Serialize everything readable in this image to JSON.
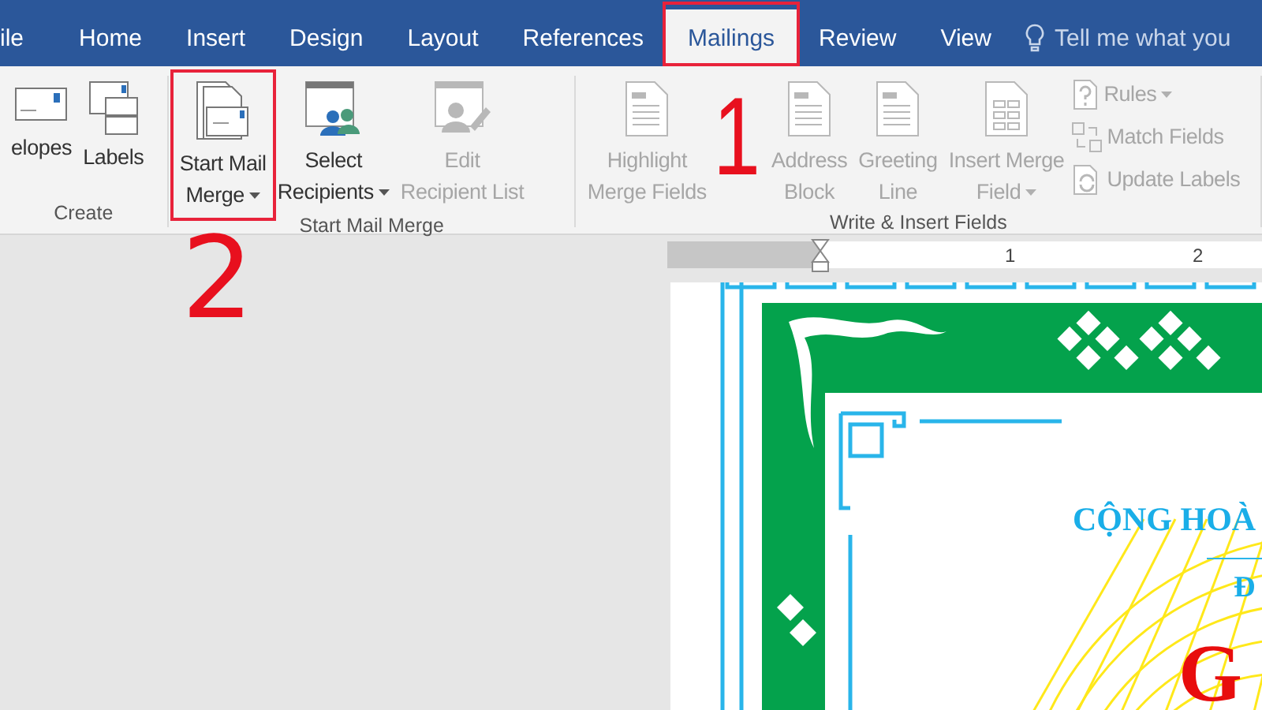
{
  "tabs": [
    {
      "label": "ile",
      "selected": false,
      "annotated": false
    },
    {
      "label": "Home",
      "selected": false,
      "annotated": false
    },
    {
      "label": "Insert",
      "selected": false,
      "annotated": false
    },
    {
      "label": "Design",
      "selected": false,
      "annotated": false
    },
    {
      "label": "Layout",
      "selected": false,
      "annotated": false
    },
    {
      "label": "References",
      "selected": false,
      "annotated": false
    },
    {
      "label": "Mailings",
      "selected": true,
      "annotated": true
    },
    {
      "label": "Review",
      "selected": false,
      "annotated": false
    },
    {
      "label": "View",
      "selected": false,
      "annotated": false
    }
  ],
  "search": {
    "placeholder": "Tell me what you"
  },
  "groups": [
    {
      "label": "Create",
      "items": [
        {
          "kind": "large",
          "lines": [
            "elopes"
          ],
          "dropdown": false,
          "disabled": false,
          "annotated": false
        },
        {
          "kind": "large",
          "lines": [
            "Labels"
          ],
          "dropdown": false,
          "disabled": false,
          "annotated": false
        }
      ]
    },
    {
      "label": "Start Mail Merge",
      "items": [
        {
          "kind": "large",
          "lines": [
            "Start Mail",
            "Merge"
          ],
          "dropdown": true,
          "disabled": false,
          "annotated": true
        },
        {
          "kind": "large",
          "lines": [
            "Select",
            "Recipients"
          ],
          "dropdown": true,
          "disabled": false,
          "annotated": false
        },
        {
          "kind": "large",
          "lines": [
            "Edit",
            "Recipient List"
          ],
          "dropdown": false,
          "disabled": true,
          "annotated": false
        }
      ]
    },
    {
      "label": "Write & Insert Fields",
      "items": [
        {
          "kind": "large",
          "lines": [
            "Highlight",
            "Merge Fields"
          ],
          "dropdown": false,
          "disabled": true,
          "annotated": false
        },
        {
          "kind": "large",
          "lines": [
            "Address",
            "Block"
          ],
          "dropdown": false,
          "disabled": true,
          "annotated": false
        },
        {
          "kind": "large",
          "lines": [
            "Greeting",
            "Line"
          ],
          "dropdown": false,
          "disabled": true,
          "annotated": false
        },
        {
          "kind": "large",
          "lines": [
            "Insert Merge",
            "Field"
          ],
          "dropdown": true,
          "disabled": true,
          "annotated": false
        },
        {
          "kind": "small",
          "lines": [
            "Rules"
          ],
          "dropdown": true,
          "disabled": true
        },
        {
          "kind": "small",
          "lines": [
            "Match Fields"
          ],
          "dropdown": false,
          "disabled": true
        },
        {
          "kind": "small",
          "lines": [
            "Update Labels"
          ],
          "dropdown": false,
          "disabled": true
        }
      ]
    }
  ],
  "annotations": [
    {
      "label": "1"
    },
    {
      "label": "2"
    }
  ],
  "ruler": {
    "numbers": [
      "1",
      "2"
    ]
  },
  "document": {
    "heading": "CỘNG HOÀ",
    "subheading": "Đ",
    "title": "G"
  }
}
